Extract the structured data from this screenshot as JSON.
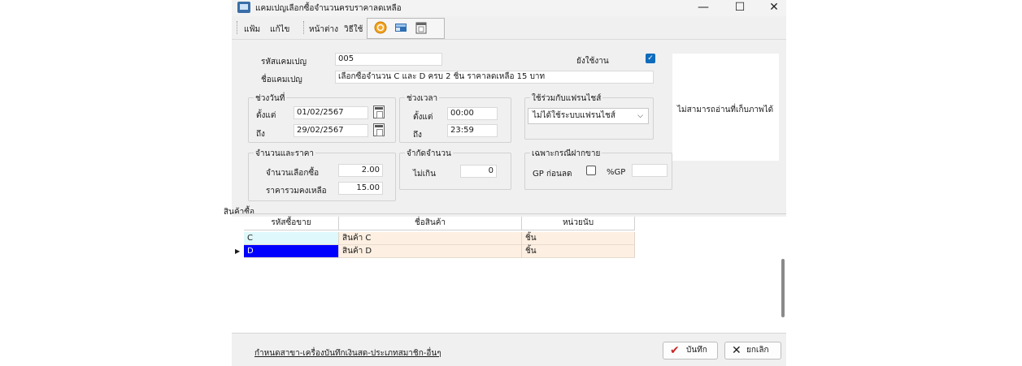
{
  "window": {
    "title": "แคมเปญเลือกซื้อจำนวนครบราคาลดเหลือ",
    "minimize": "—",
    "maximize": "☐",
    "close": "✕"
  },
  "menu": {
    "file": "แฟ้ม",
    "edit": "แก้ไข",
    "window": "หน้าต่าง",
    "help": "วิธีใช้"
  },
  "toolbar_icons": [
    "refresh-icon",
    "table-icon",
    "calendar-icon"
  ],
  "form": {
    "campaign_code_label": "รหัสแคมเปญ",
    "campaign_code": "005",
    "campaign_name_label": "ชื่อแคมเปญ",
    "campaign_name": "เลือกซื้อจำนวน C และ D ครบ 2 ชิ้น ราคาลดเหลือ 15 บาท",
    "active_label": "ยังใช้งาน",
    "active_checked": true,
    "date_range": {
      "title": "ช่วงวันที่",
      "from_label": "ตั้งแต่",
      "from": "01/02/2567",
      "to_label": "ถึง",
      "to": "29/02/2567"
    },
    "time_range": {
      "title": "ช่วงเวลา",
      "from_label": "ตั้งแต่",
      "from": "00:00",
      "to_label": "ถึง",
      "to": "23:59"
    },
    "franchise": {
      "title": "ใช้ร่วมกับแฟรนไชส์",
      "selected": "ไม่ได้ใช้ระบบแฟรนไชส์"
    },
    "qty_price": {
      "title": "จำนวนและราคา",
      "qty_label": "จำนวนเลือกซื้อ",
      "qty": "2.00",
      "total_label": "ราคารวมคงเหลือ",
      "total": "15.00"
    },
    "limit": {
      "title": "จำกัดจำนวน",
      "max_label": "ไม่เกิน",
      "max": "0"
    },
    "consign": {
      "title": "เฉพาะกรณีฝากขาย",
      "gp_before_label": "GP ก่อนลด",
      "gp_before_checked": false,
      "gp_pct_label": "%GP",
      "gp_pct": ""
    },
    "image_msg": "ไม่สามารถอ่านที่เก็บภาพได้"
  },
  "grid": {
    "section_title": "สินค้าซื้อ",
    "columns": [
      "รหัสซื้อขาย",
      "ชื่อสินค้า",
      "หน่วยนับ"
    ],
    "rows": [
      {
        "code": "C",
        "name": "สินค้า C",
        "unit": "ชิ้น"
      },
      {
        "code": "D",
        "name": "สินค้า D",
        "unit": "ชิ้น"
      }
    ],
    "current_row_marker": "▶"
  },
  "footer": {
    "link": "กำหนดสาขา-เครื่องบันทึกเงินสด-ประเภทสมาชิก-อื่นๆ",
    "save_label": "บันทึก",
    "cancel_label": "ยกเลิก"
  },
  "colors": {
    "accent": "#0f6cbd",
    "row_code_bg": "#dff8fb",
    "row_bg": "#fdefe1",
    "selected_bg": "#0000ff",
    "save_check": "#c62828"
  }
}
